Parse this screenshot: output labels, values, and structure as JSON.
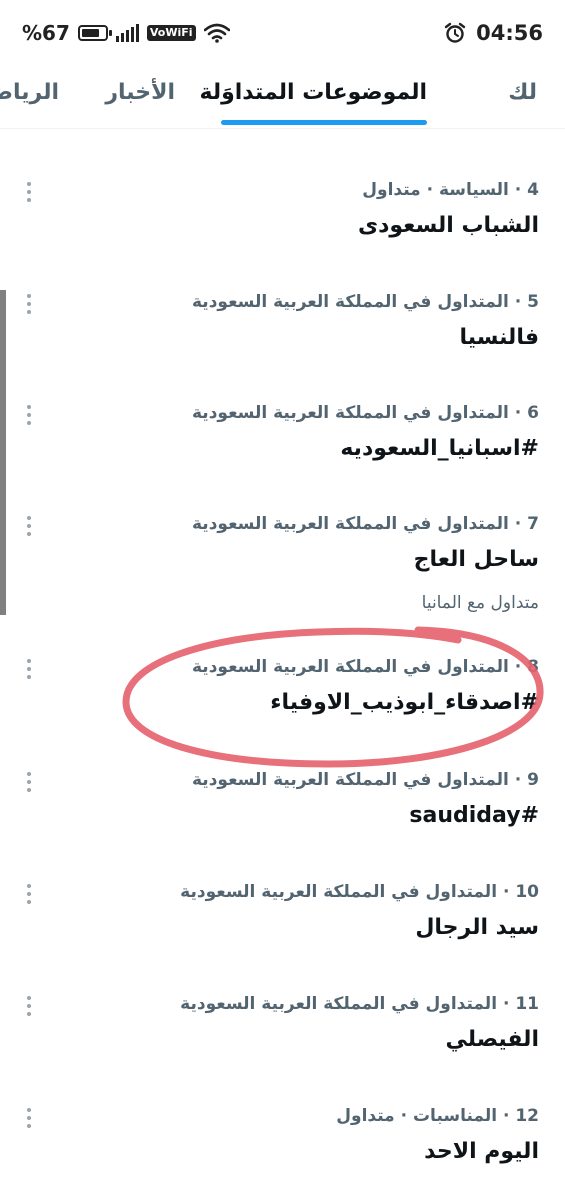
{
  "status_bar": {
    "battery_text": "%67",
    "network_badge": "VoWiFi",
    "time": "04:56",
    "icons": [
      "battery-icon",
      "signal-icon",
      "vowifi-icon",
      "wifi-icon",
      "alarm-icon"
    ]
  },
  "tabs": [
    {
      "label": "لك",
      "active": false
    },
    {
      "label": "الموضوعات المتداوَلة",
      "active": true
    },
    {
      "label": "الأخبار",
      "active": false
    },
    {
      "label": "الرياضة",
      "active": false
    }
  ],
  "trends": [
    {
      "meta": "4 · السياسة · متداول",
      "title": "الشباب السعودى",
      "sub": ""
    },
    {
      "meta": "5 · المتداول في المملكة العربية السعودية",
      "title": "فالنسيا",
      "sub": ""
    },
    {
      "meta": "6 · المتداول في المملكة العربية السعودية",
      "title": "#اسبانيا_السعوديه",
      "sub": ""
    },
    {
      "meta": "7 · المتداول في المملكة العربية السعودية",
      "title": "ساحل العاج",
      "sub": "متداول مع المانيا"
    },
    {
      "meta": "8 · المتداول في المملكة العربية السعودية",
      "title": "#اصدقاء_ابوذيب_الاوفياء",
      "sub": ""
    },
    {
      "meta": "9 · المتداول في المملكة العربية السعودية",
      "title": "#saudiday",
      "sub": ""
    },
    {
      "meta": "10 · المتداول في المملكة العربية السعودية",
      "title": "سيد الرجال",
      "sub": ""
    },
    {
      "meta": "11 · المتداول في المملكة العربية السعودية",
      "title": "الفيصلي",
      "sub": ""
    },
    {
      "meta": "12 · المناسبات · متداول",
      "title": "اليوم الاحد",
      "sub": ""
    }
  ],
  "colors": {
    "accent": "#1d9bf0",
    "secondary_text": "#536471",
    "annotation": "#e4606d"
  }
}
